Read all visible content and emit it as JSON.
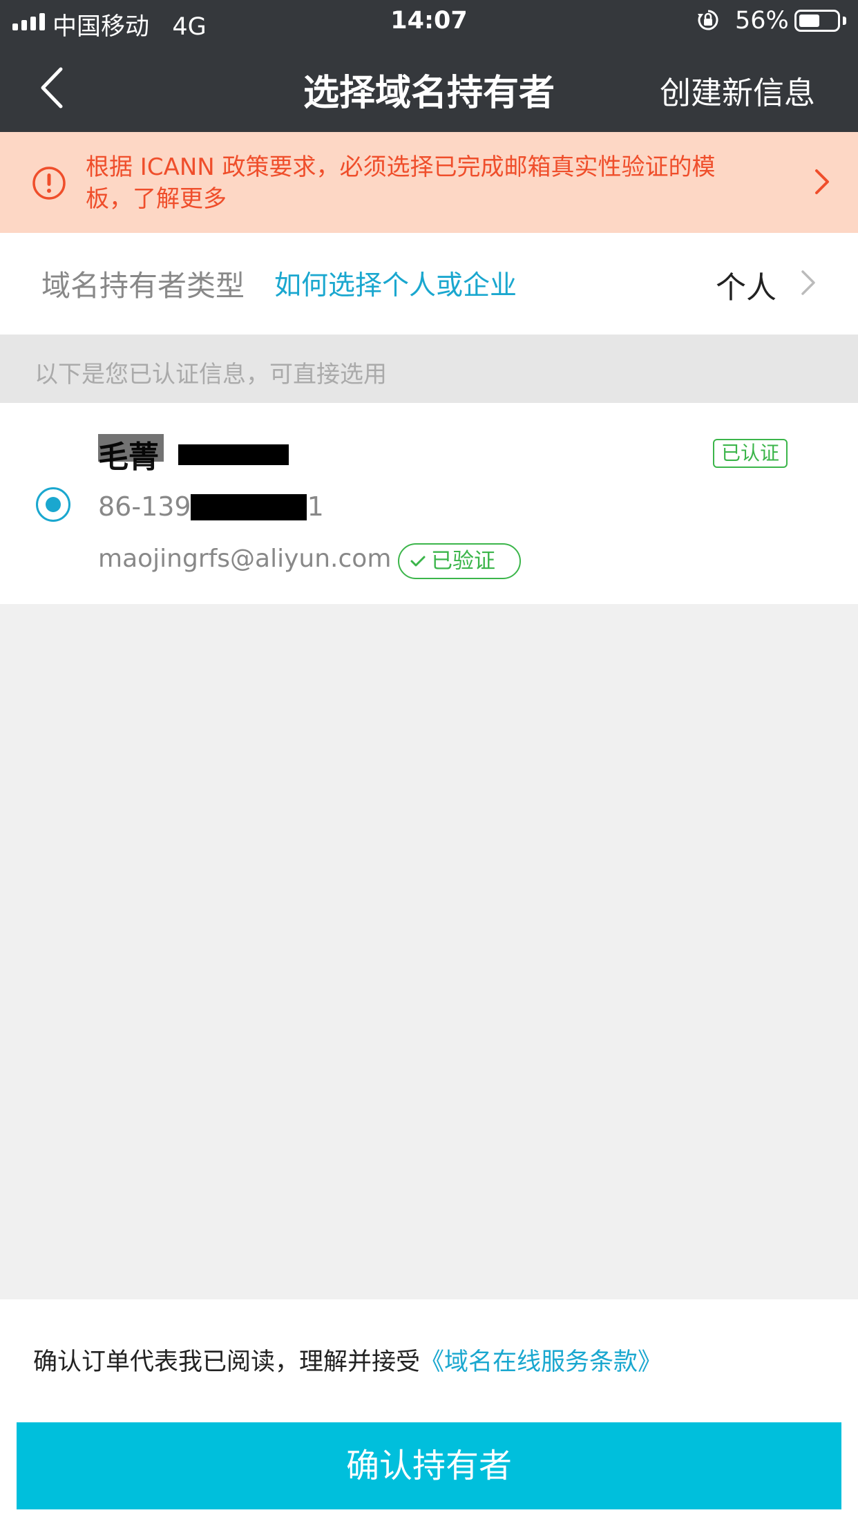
{
  "status_bar": {
    "carrier": "中国移动",
    "network": "4G",
    "time": "14:07",
    "battery_percent": "56%",
    "battery_level": 0.56
  },
  "nav": {
    "title": "选择域名持有者",
    "action": "创建新信息",
    "back_icon": "chevron-left-icon"
  },
  "banner": {
    "text": "根据 ICANN 政策要求，必须选择已完成邮箱真实性验证的模板，了解更多",
    "color": "#ef4e2b",
    "background": "#fdd7c5"
  },
  "owner_type": {
    "label": "域名持有者类型",
    "help_link": "如何选择个人或企业",
    "value": "个人"
  },
  "hint": "以下是您已认证信息，可直接选用",
  "contact": {
    "name": "毛菁",
    "phone_prefix": "86-139",
    "phone_suffix": "1",
    "email": "maojingrfs@aliyun.com",
    "verified_badge": "已认证",
    "email_badge": "已验证",
    "selected": true
  },
  "footer": {
    "terms_text": "确认订单代表我已阅读，理解并接受",
    "terms_link": "《域名在线服务条款》",
    "confirm_button": "确认持有者"
  },
  "colors": {
    "accent": "#00bfdc",
    "link": "#1aa7cf",
    "success": "#3bb54a",
    "header": "#35383c"
  }
}
